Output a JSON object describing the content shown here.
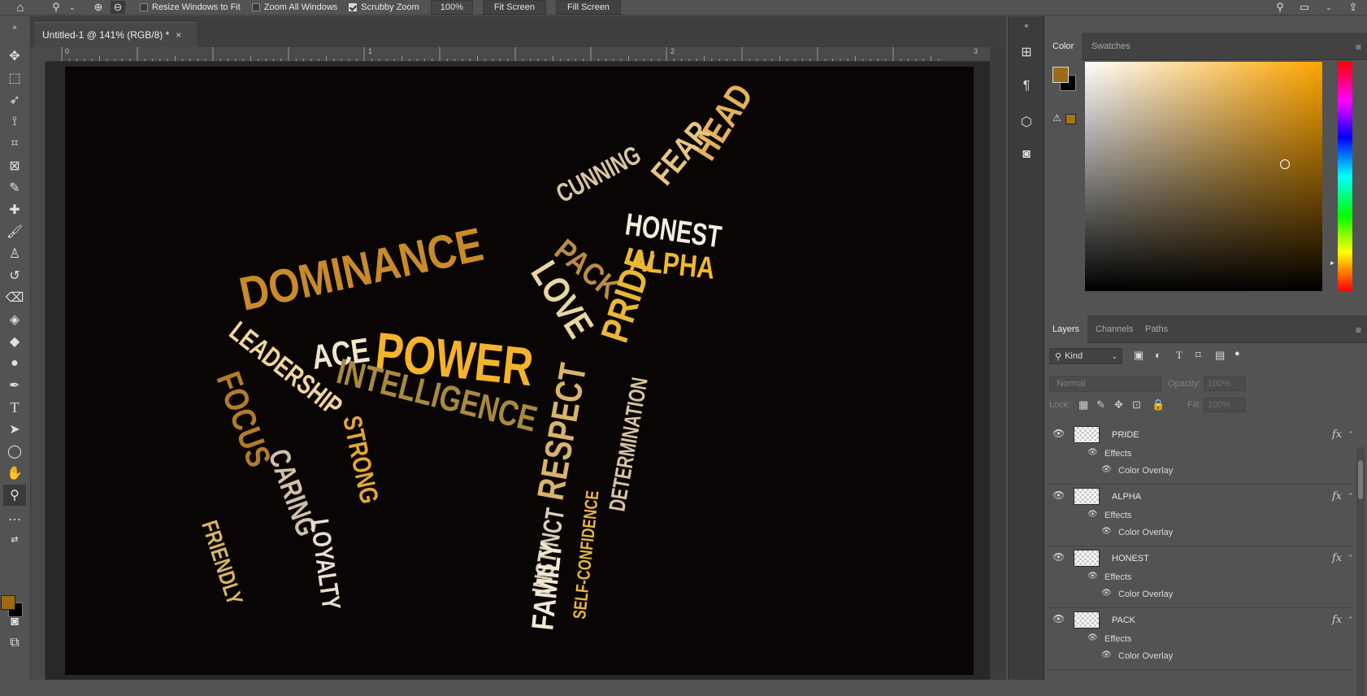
{
  "topbar": {
    "resize_windows": "Resize Windows to Fit",
    "zoom_all": "Zoom All Windows",
    "scrubby_zoom": "Scrubby Zoom",
    "zoom_value": "100%",
    "fit_screen": "Fit Screen",
    "fill_screen": "Fill Screen"
  },
  "document": {
    "tab_title": "Untitled-1 @ 141% (RGB/8) *",
    "close": "×"
  },
  "ruler": {
    "h": [
      "0",
      "1",
      "2",
      "3"
    ]
  },
  "artwork": {
    "words": [
      "HEAD",
      "FEAR",
      "CUNNING",
      "HONEST",
      "PACK",
      "ALPHA",
      "LOVE",
      "PRIDE",
      "DOMINANCE",
      "LEADERSHIP",
      "ACE",
      "POWER",
      "INTELLIGENCE",
      "RESPECT",
      "DETERMINATION",
      "INSTINCT",
      "FOCUS",
      "CARING",
      "STRONG",
      "FRIENDLY",
      "LOYALTY",
      "FAMILY",
      "SELF-CONFIDENCE"
    ]
  },
  "color_panel": {
    "tabs": [
      "Color",
      "Swatches"
    ],
    "foreground": "#9c6b12",
    "background": "#000000",
    "hue": "#ffa500"
  },
  "layers_panel": {
    "tabs": [
      "Layers",
      "Channels",
      "Paths"
    ],
    "kind": "Kind",
    "blend_mode": "Normal",
    "opacity_label": "Opacity:",
    "opacity_value": "100%",
    "lock_label": "Lock:",
    "fill_label": "Fill:",
    "fill_value": "100%",
    "layers": [
      {
        "name": "PRIDE",
        "effects": "Effects",
        "effect": "Color Overlay"
      },
      {
        "name": "ALPHA",
        "effects": "Effects",
        "effect": "Color Overlay"
      },
      {
        "name": "HONEST",
        "effects": "Effects",
        "effect": "Color Overlay"
      },
      {
        "name": "PACK",
        "effects": "Effects",
        "effect": "Color Overlay"
      }
    ]
  }
}
